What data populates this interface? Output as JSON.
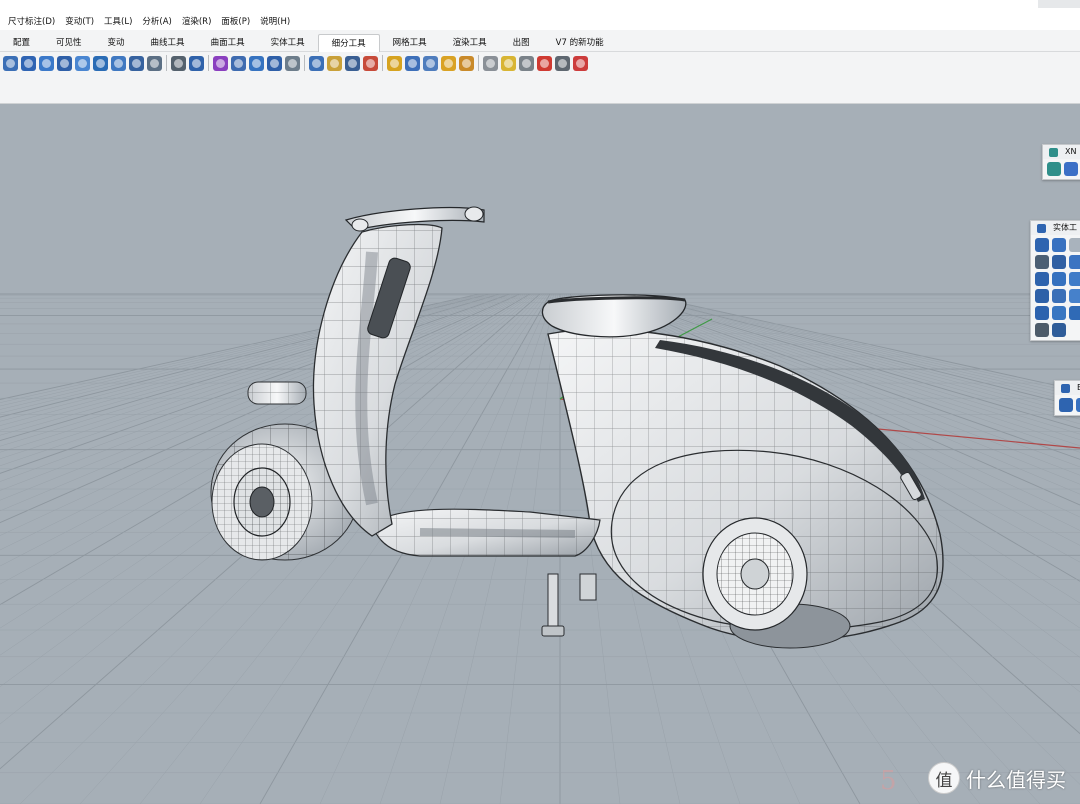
{
  "menu": [
    "尺寸标注(D)",
    "变动(T)",
    "工具(L)",
    "分析(A)",
    "渲染(R)",
    "面板(P)",
    "说明(H)"
  ],
  "tabs": [
    {
      "label": "配置",
      "active": false
    },
    {
      "label": "可见性",
      "active": false
    },
    {
      "label": "变动",
      "active": false
    },
    {
      "label": "曲线工具",
      "active": false
    },
    {
      "label": "曲面工具",
      "active": false
    },
    {
      "label": "实体工具",
      "active": false
    },
    {
      "label": "细分工具",
      "active": true
    },
    {
      "label": "网格工具",
      "active": false
    },
    {
      "label": "渲染工具",
      "active": false
    },
    {
      "label": "出图",
      "active": false
    },
    {
      "label": "V7 的新功能",
      "active": false
    }
  ],
  "toolbar_icons": [
    {
      "name": "subd-edit",
      "color": "#3b6fb6"
    },
    {
      "name": "subd-sphere",
      "color": "#2f64b3"
    },
    {
      "name": "subd-cylinder",
      "color": "#3b79c9"
    },
    {
      "name": "subd-plane",
      "color": "#2e5fa8"
    },
    {
      "name": "subd-torus",
      "color": "#4a86d1"
    },
    {
      "name": "subd-box",
      "color": "#2a6cb5"
    },
    {
      "name": "subd-cone",
      "color": "#3f78c1"
    },
    {
      "name": "subd-quadball",
      "color": "#36629f"
    },
    {
      "name": "subd-mesh",
      "color": "#5b6f84"
    },
    {
      "name": "sep"
    },
    {
      "name": "subd-bridge",
      "color": "#54616d"
    },
    {
      "name": "subd-fill",
      "color": "#2f62aa"
    },
    {
      "name": "sep"
    },
    {
      "name": "subd-crease",
      "color": "#8a3fbf"
    },
    {
      "name": "subd-remove-crease",
      "color": "#3e6bb0"
    },
    {
      "name": "subd-weld",
      "color": "#3673c0"
    },
    {
      "name": "subd-insert-edge",
      "color": "#2e5fa8"
    },
    {
      "name": "subd-symmetry",
      "color": "#6d7d8b"
    },
    {
      "name": "sep"
    },
    {
      "name": "subd-extrude",
      "color": "#3b6fb6"
    },
    {
      "name": "subd-offset",
      "color": "#c9a13a"
    },
    {
      "name": "subd-stitch",
      "color": "#3a5f93"
    },
    {
      "name": "subd-append",
      "color": "#c74b3a"
    },
    {
      "name": "sep"
    },
    {
      "name": "subd-loft",
      "color": "#d6a320"
    },
    {
      "name": "subd-sweep",
      "color": "#3d6fb9"
    },
    {
      "name": "subd-rail",
      "color": "#4f7dbd"
    },
    {
      "name": "subd-pipe",
      "color": "#d9a224"
    },
    {
      "name": "subd-brush",
      "color": "#c98a2a"
    },
    {
      "name": "sep"
    },
    {
      "name": "subd-smooth",
      "color": "#8a9097"
    },
    {
      "name": "subd-select",
      "color": "#d8b534"
    },
    {
      "name": "subd-filter",
      "color": "#7a8289"
    },
    {
      "name": "subd-delete",
      "color": "#cf3a32"
    },
    {
      "name": "subd-history",
      "color": "#5e6770"
    },
    {
      "name": "subd-close",
      "color": "#cc3c3c"
    }
  ],
  "panel_xn": {
    "title": "XN",
    "icons": [
      {
        "name": "xn-align",
        "color": "#2f8f8a"
      },
      {
        "name": "help",
        "color": "#3b6fc6"
      }
    ]
  },
  "panel_solid": {
    "title": "实体工",
    "icons": [
      {
        "name": "boolean-union",
        "color": "#2e64b0"
      },
      {
        "name": "boolean-difference",
        "color": "#3871c0"
      },
      {
        "name": "boolean-split",
        "color": "#a9b3bd"
      },
      {
        "name": "cap-holes",
        "color": "#4b5f74"
      },
      {
        "name": "extract-surface",
        "color": "#2f5fa3"
      },
      {
        "name": "shell",
        "color": "#3b74c2"
      },
      {
        "name": "fillet-edge",
        "color": "#2e63ad"
      },
      {
        "name": "chamfer-edge",
        "color": "#3571bf"
      },
      {
        "name": "blend-edge",
        "color": "#3f7cc8"
      },
      {
        "name": "move-face",
        "color": "#2d60a8"
      },
      {
        "name": "split-face",
        "color": "#3a6fb7"
      },
      {
        "name": "extrude-face",
        "color": "#4681cb"
      },
      {
        "name": "move-edge",
        "color": "#2c62ae"
      },
      {
        "name": "wire-cut",
        "color": "#3876c2"
      },
      {
        "name": "make-hole",
        "color": "#2f6ab6"
      },
      {
        "name": "history",
        "color": "#4d5b69"
      },
      {
        "name": "bucket",
        "color": "#2e5c99"
      }
    ]
  },
  "panel_small": {
    "title": "B",
    "icons": [
      {
        "name": "box-solid",
        "color": "#2e64b0"
      },
      {
        "name": "box-split",
        "color": "#3871c0"
      }
    ]
  },
  "watermark": {
    "badge": "值",
    "text": "什么值得买",
    "faint": "5"
  }
}
